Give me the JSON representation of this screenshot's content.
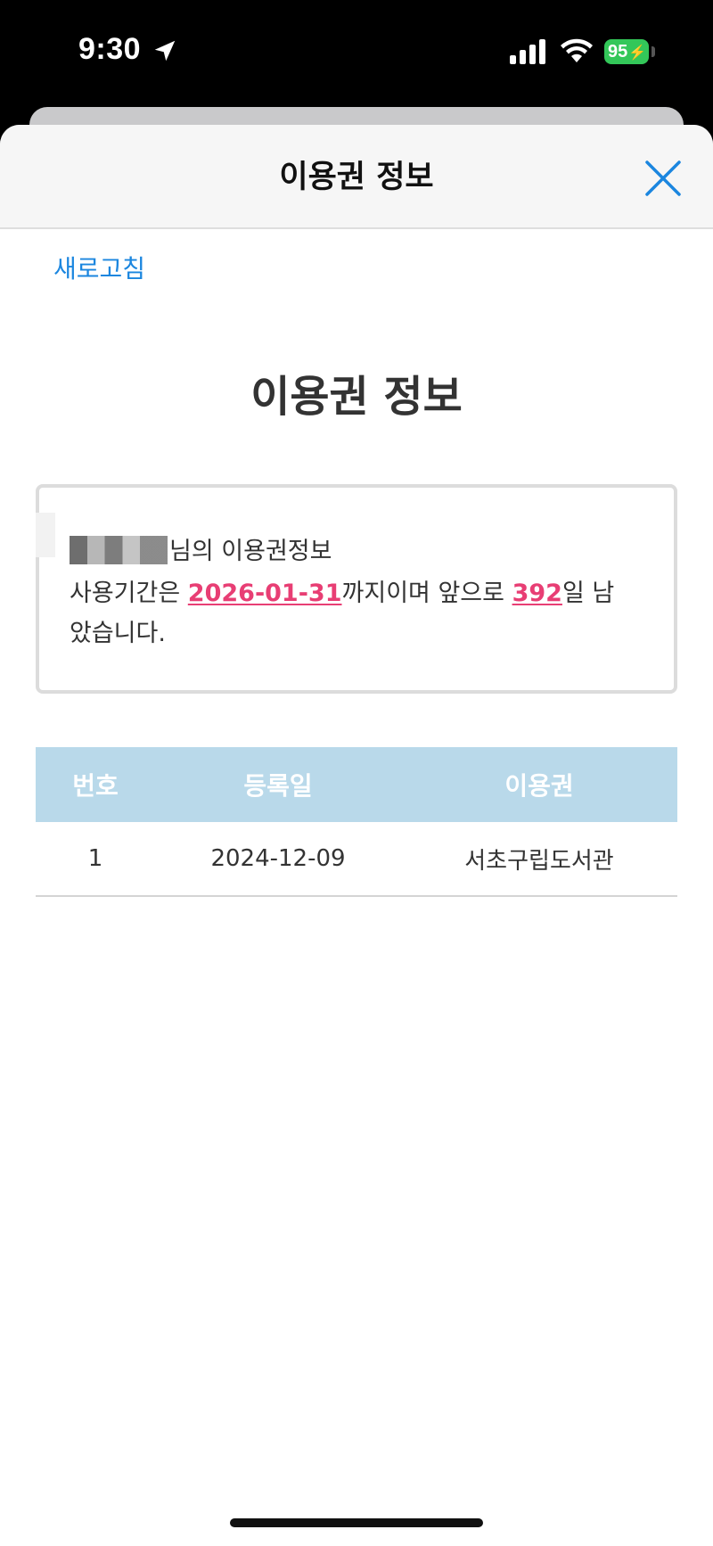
{
  "status_bar": {
    "time": "9:30",
    "battery_level": "95",
    "icons": [
      "location-arrow-icon",
      "cellular-signal-icon",
      "wifi-icon",
      "battery-charging-icon"
    ]
  },
  "sheet": {
    "header_title": "이용권 정보",
    "close_icon": "close-icon"
  },
  "refresh_label": "새로고침",
  "page_title": "이용권 정보",
  "info": {
    "name_suffix": "님의 이용권정보",
    "period_prefix": "사용기간은 ",
    "end_date": "2026-01-31",
    "period_middle": "까지이며 앞으로 ",
    "days_left": "392",
    "period_suffix": "일 남",
    "line3": "았습니다."
  },
  "table": {
    "headers": [
      "번호",
      "등록일",
      "이용권"
    ],
    "rows": [
      [
        "1",
        "2024-12-09",
        "서초구립도서관"
      ]
    ]
  },
  "colors": {
    "accent_link": "#1b86df",
    "highlight": "#e83e74",
    "table_header_bg": "#b9d9ea",
    "battery_green": "#33c759"
  }
}
